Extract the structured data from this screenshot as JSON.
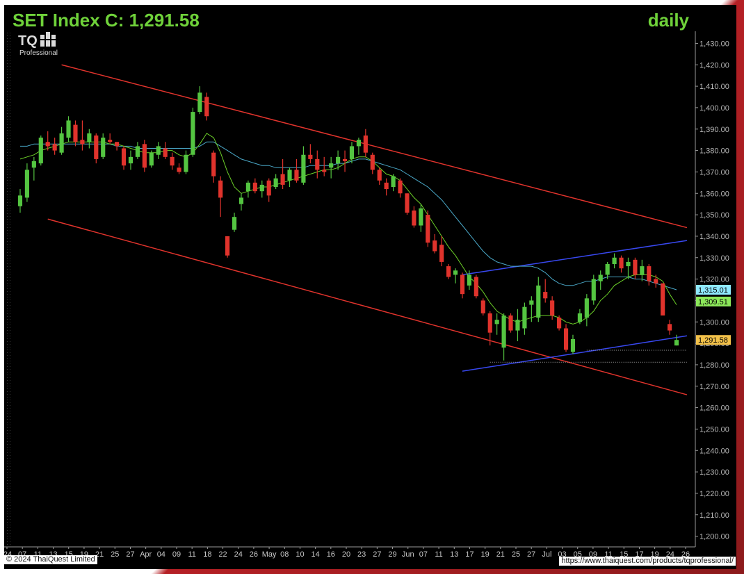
{
  "title": "SET Index C: 1,291.58",
  "period": "daily",
  "logo": {
    "mark": "TQ",
    "sub": "Professional"
  },
  "footer": {
    "copyright": "© 2024 ThaiQuest Limited",
    "url": "https://www.thaiquest.com/products/tqprofessional/"
  },
  "colors": {
    "title": "#6fd23a",
    "up": "#54c541",
    "down": "#e0332c",
    "channel": "#e0332c",
    "support": "#3848f0",
    "ma_short": "#6ccf28",
    "ma_long": "#4aa8c8",
    "price_tag": "#f2c14a",
    "ma_long_tag": "#8fe9ff",
    "ma_short_tag": "#8ce85a"
  },
  "chart_data": {
    "type": "candlestick",
    "title": "SET Index C: 1,291.58",
    "period": "daily",
    "ylim": [
      1195,
      1435
    ],
    "y_ticks": [
      1200,
      1210,
      1220,
      1230,
      1240,
      1250,
      1260,
      1270,
      1280,
      1290,
      1300,
      1310,
      1320,
      1330,
      1340,
      1350,
      1360,
      1370,
      1380,
      1390,
      1400,
      1410,
      1420,
      1430
    ],
    "x_labels": [
      "'24",
      "07",
      "11",
      "13",
      "15",
      "19",
      "21",
      "25",
      "27",
      "Apr",
      "04",
      "09",
      "11",
      "18",
      "22",
      "24",
      "26",
      "May",
      "08",
      "10",
      "14",
      "16",
      "20",
      "23",
      "27",
      "29",
      "Jun",
      "07",
      "11",
      "13",
      "17",
      "19",
      "21",
      "25",
      "27",
      "Jul",
      "03",
      "05",
      "09",
      "11",
      "15",
      "17",
      "19",
      "24",
      "26"
    ],
    "last_values": {
      "price": "1,291.58",
      "ma_long": "1,315.01",
      "ma_short": "1,309.51"
    },
    "candles": [
      {
        "o": 1354,
        "h": 1362,
        "l": 1351,
        "c": 1359
      },
      {
        "o": 1358,
        "h": 1374,
        "l": 1356,
        "c": 1371
      },
      {
        "o": 1372,
        "h": 1377,
        "l": 1366,
        "c": 1375
      },
      {
        "o": 1374,
        "h": 1387,
        "l": 1373,
        "c": 1386
      },
      {
        "o": 1384,
        "h": 1389,
        "l": 1380,
        "c": 1382
      },
      {
        "o": 1383,
        "h": 1386,
        "l": 1378,
        "c": 1380
      },
      {
        "o": 1379,
        "h": 1391,
        "l": 1378,
        "c": 1388
      },
      {
        "o": 1386,
        "h": 1396,
        "l": 1384,
        "c": 1394
      },
      {
        "o": 1392,
        "h": 1394,
        "l": 1382,
        "c": 1384
      },
      {
        "o": 1385,
        "h": 1394,
        "l": 1380,
        "c": 1383
      },
      {
        "o": 1384,
        "h": 1390,
        "l": 1381,
        "c": 1388
      },
      {
        "o": 1387,
        "h": 1388,
        "l": 1374,
        "c": 1376
      },
      {
        "o": 1377,
        "h": 1388,
        "l": 1376,
        "c": 1386
      },
      {
        "o": 1385,
        "h": 1388,
        "l": 1383,
        "c": 1384
      },
      {
        "o": 1384,
        "h": 1384,
        "l": 1380,
        "c": 1382
      },
      {
        "o": 1381,
        "h": 1382,
        "l": 1371,
        "c": 1373
      },
      {
        "o": 1374,
        "h": 1380,
        "l": 1371,
        "c": 1377
      },
      {
        "o": 1377,
        "h": 1384,
        "l": 1376,
        "c": 1382
      },
      {
        "o": 1383,
        "h": 1385,
        "l": 1370,
        "c": 1372
      },
      {
        "o": 1373,
        "h": 1380,
        "l": 1372,
        "c": 1379
      },
      {
        "o": 1378,
        "h": 1384,
        "l": 1376,
        "c": 1382
      },
      {
        "o": 1381,
        "h": 1384,
        "l": 1376,
        "c": 1377
      },
      {
        "o": 1377,
        "h": 1379,
        "l": 1371,
        "c": 1373
      },
      {
        "o": 1372,
        "h": 1374,
        "l": 1369,
        "c": 1370
      },
      {
        "o": 1370,
        "h": 1380,
        "l": 1369,
        "c": 1378
      },
      {
        "o": 1378,
        "h": 1400,
        "l": 1377,
        "c": 1398
      },
      {
        "o": 1398,
        "h": 1410,
        "l": 1397,
        "c": 1407
      },
      {
        "o": 1405,
        "h": 1407,
        "l": 1394,
        "c": 1396
      },
      {
        "o": 1379,
        "h": 1380,
        "l": 1365,
        "c": 1368
      },
      {
        "o": 1366,
        "h": 1368,
        "l": 1349,
        "c": 1358
      },
      {
        "o": 1340,
        "h": 1340,
        "l": 1330,
        "c": 1331
      },
      {
        "o": 1343,
        "h": 1351,
        "l": 1342,
        "c": 1349
      },
      {
        "o": 1355,
        "h": 1360,
        "l": 1352,
        "c": 1358
      },
      {
        "o": 1361,
        "h": 1366,
        "l": 1358,
        "c": 1365
      },
      {
        "o": 1365,
        "h": 1367,
        "l": 1360,
        "c": 1361
      },
      {
        "o": 1361,
        "h": 1366,
        "l": 1358,
        "c": 1364
      },
      {
        "o": 1366,
        "h": 1367,
        "l": 1356,
        "c": 1359
      },
      {
        "o": 1363,
        "h": 1369,
        "l": 1362,
        "c": 1367
      },
      {
        "o": 1369,
        "h": 1376,
        "l": 1362,
        "c": 1364
      },
      {
        "o": 1366,
        "h": 1372,
        "l": 1363,
        "c": 1371
      },
      {
        "o": 1371,
        "h": 1376,
        "l": 1365,
        "c": 1366
      },
      {
        "o": 1365,
        "h": 1382,
        "l": 1364,
        "c": 1378
      },
      {
        "o": 1378,
        "h": 1383,
        "l": 1374,
        "c": 1376
      },
      {
        "o": 1376,
        "h": 1380,
        "l": 1367,
        "c": 1371
      },
      {
        "o": 1371,
        "h": 1377,
        "l": 1368,
        "c": 1370
      },
      {
        "o": 1372,
        "h": 1377,
        "l": 1367,
        "c": 1374
      },
      {
        "o": 1374,
        "h": 1380,
        "l": 1371,
        "c": 1377
      },
      {
        "o": 1376,
        "h": 1380,
        "l": 1370,
        "c": 1375
      },
      {
        "o": 1376,
        "h": 1384,
        "l": 1374,
        "c": 1382
      },
      {
        "o": 1382,
        "h": 1386,
        "l": 1378,
        "c": 1385
      },
      {
        "o": 1387,
        "h": 1390,
        "l": 1377,
        "c": 1379
      },
      {
        "o": 1378,
        "h": 1379,
        "l": 1369,
        "c": 1371
      },
      {
        "o": 1371,
        "h": 1372,
        "l": 1364,
        "c": 1366
      },
      {
        "o": 1365,
        "h": 1367,
        "l": 1359,
        "c": 1362
      },
      {
        "o": 1363,
        "h": 1369,
        "l": 1361,
        "c": 1368
      },
      {
        "o": 1366,
        "h": 1367,
        "l": 1358,
        "c": 1360
      },
      {
        "o": 1360,
        "h": 1360,
        "l": 1350,
        "c": 1351
      },
      {
        "o": 1352,
        "h": 1354,
        "l": 1344,
        "c": 1345
      },
      {
        "o": 1345,
        "h": 1355,
        "l": 1342,
        "c": 1353
      },
      {
        "o": 1350,
        "h": 1352,
        "l": 1335,
        "c": 1337
      },
      {
        "o": 1338,
        "h": 1341,
        "l": 1332,
        "c": 1333
      },
      {
        "o": 1336,
        "h": 1340,
        "l": 1326,
        "c": 1328
      },
      {
        "o": 1326,
        "h": 1327,
        "l": 1320,
        "c": 1321
      },
      {
        "o": 1322,
        "h": 1325,
        "l": 1318,
        "c": 1324
      },
      {
        "o": 1322,
        "h": 1323,
        "l": 1311,
        "c": 1313
      },
      {
        "o": 1317,
        "h": 1324,
        "l": 1315,
        "c": 1322
      },
      {
        "o": 1321,
        "h": 1322,
        "l": 1311,
        "c": 1312
      },
      {
        "o": 1310,
        "h": 1311,
        "l": 1303,
        "c": 1304
      },
      {
        "o": 1304,
        "h": 1305,
        "l": 1289,
        "c": 1295
      },
      {
        "o": 1299,
        "h": 1304,
        "l": 1294,
        "c": 1301
      },
      {
        "o": 1288,
        "h": 1304,
        "l": 1282,
        "c": 1303
      },
      {
        "o": 1303,
        "h": 1304,
        "l": 1295,
        "c": 1296
      },
      {
        "o": 1296,
        "h": 1306,
        "l": 1291,
        "c": 1301
      },
      {
        "o": 1297,
        "h": 1309,
        "l": 1294,
        "c": 1307
      },
      {
        "o": 1308,
        "h": 1312,
        "l": 1300,
        "c": 1310
      },
      {
        "o": 1302,
        "h": 1321,
        "l": 1300,
        "c": 1317
      },
      {
        "o": 1314,
        "h": 1320,
        "l": 1309,
        "c": 1311
      },
      {
        "o": 1310,
        "h": 1312,
        "l": 1301,
        "c": 1303
      },
      {
        "o": 1302,
        "h": 1303,
        "l": 1296,
        "c": 1297
      },
      {
        "o": 1297,
        "h": 1299,
        "l": 1286,
        "c": 1287
      },
      {
        "o": 1286,
        "h": 1294,
        "l": 1285,
        "c": 1292
      },
      {
        "o": 1300,
        "h": 1306,
        "l": 1299,
        "c": 1304
      },
      {
        "o": 1302,
        "h": 1313,
        "l": 1298,
        "c": 1311
      },
      {
        "o": 1310,
        "h": 1322,
        "l": 1308,
        "c": 1320
      },
      {
        "o": 1319,
        "h": 1324,
        "l": 1315,
        "c": 1322
      },
      {
        "o": 1322,
        "h": 1328,
        "l": 1320,
        "c": 1327
      },
      {
        "o": 1327,
        "h": 1332,
        "l": 1325,
        "c": 1330
      },
      {
        "o": 1330,
        "h": 1331,
        "l": 1323,
        "c": 1325
      },
      {
        "o": 1326,
        "h": 1330,
        "l": 1320,
        "c": 1328
      },
      {
        "o": 1329,
        "h": 1330,
        "l": 1320,
        "c": 1322
      },
      {
        "o": 1322,
        "h": 1329,
        "l": 1319,
        "c": 1326
      },
      {
        "o": 1326,
        "h": 1327,
        "l": 1317,
        "c": 1319
      },
      {
        "o": 1320,
        "h": 1322,
        "l": 1316,
        "c": 1318
      },
      {
        "o": 1318,
        "h": 1318,
        "l": 1303,
        "c": 1303
      },
      {
        "o": 1299,
        "h": 1301,
        "l": 1294,
        "c": 1296
      },
      {
        "o": 1289,
        "h": 1294,
        "l": 1289,
        "c": 1291.58
      }
    ],
    "ma_short": [
      1376,
      1377,
      1378,
      1380,
      1381,
      1382,
      1383,
      1384,
      1384,
      1384,
      1384,
      1384,
      1384,
      1383,
      1383,
      1382,
      1381,
      1380,
      1379,
      1379,
      1379,
      1380,
      1380,
      1378,
      1377,
      1379,
      1383,
      1388,
      1386,
      1379,
      1370,
      1363,
      1360,
      1361,
      1362,
      1363,
      1363,
      1364,
      1365,
      1366,
      1367,
      1368,
      1369,
      1370,
      1371,
      1371,
      1372,
      1374,
      1376,
      1377,
      1377,
      1375,
      1372,
      1369,
      1368,
      1366,
      1362,
      1358,
      1355,
      1350,
      1345,
      1340,
      1335,
      1331,
      1326,
      1321,
      1318,
      1314,
      1309,
      1305,
      1303,
      1301,
      1300,
      1301,
      1302,
      1303,
      1303,
      1303,
      1302,
      1300,
      1299,
      1300,
      1302,
      1305,
      1310,
      1313,
      1317,
      1319,
      1321,
      1322,
      1322,
      1322,
      1321,
      1319,
      1313,
      1308
    ],
    "ma_long": [
      1382,
      1382,
      1383,
      1383,
      1383,
      1383,
      1383,
      1383,
      1383,
      1383,
      1383,
      1383,
      1383,
      1383,
      1382,
      1382,
      1382,
      1381,
      1381,
      1381,
      1381,
      1381,
      1381,
      1381,
      1381,
      1381,
      1382,
      1384,
      1384,
      1382,
      1380,
      1378,
      1376,
      1375,
      1374,
      1373,
      1373,
      1372,
      1372,
      1372,
      1372,
      1372,
      1373,
      1373,
      1373,
      1373,
      1374,
      1374,
      1375,
      1376,
      1376,
      1375,
      1374,
      1373,
      1372,
      1371,
      1369,
      1367,
      1365,
      1363,
      1360,
      1357,
      1353,
      1349,
      1345,
      1341,
      1337,
      1333,
      1330,
      1328,
      1327,
      1326,
      1326,
      1326,
      1326,
      1325,
      1323,
      1320,
      1318,
      1317,
      1317,
      1318,
      1319,
      1319,
      1320,
      1321,
      1321,
      1321,
      1321,
      1320,
      1320,
      1319,
      1318,
      1317,
      1316,
      1315
    ]
  }
}
